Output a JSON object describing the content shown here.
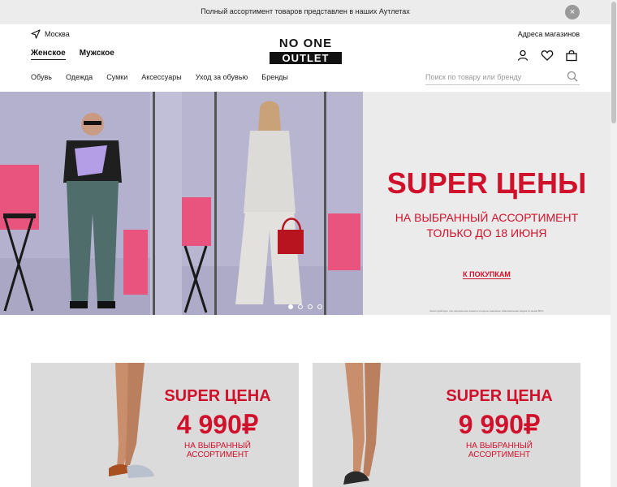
{
  "topbar": {
    "text": "Полный ассортимент товаров представлен в наших Аутлетах",
    "close": "×"
  },
  "header": {
    "city": "Москва",
    "store_link": "Адреса магазинов",
    "logo_top": "NO ONE",
    "logo_bottom": "OUTLET",
    "gender_tabs": [
      "Женское",
      "Мужское"
    ],
    "nav": [
      "Обувь",
      "Одежда",
      "Сумки",
      "Аксессуары",
      "Уход за обувью",
      "Бренды"
    ],
    "search_placeholder": "Поиск по товару или бренду"
  },
  "hero": {
    "title": "SUPER ЦЕНЫ",
    "subtitle_line1": "НА ВЫБРАННЫЙ АССОРТИМЕНТ",
    "subtitle_line2": "ТОЛЬКО ДО 18 ИЮНЯ",
    "cta": "К ПОКУПКАМ",
    "footnote": "Акция действует при оформлении заказа в интернет-магазине. Максимальная скидка по акции 80%.",
    "slides_count": 4,
    "active_slide": 1
  },
  "promos": [
    {
      "title": "SUPER ЦЕНА",
      "price": "4 990₽",
      "subtitle": "НА ВЫБРАННЫЙ АССОРТИМЕНТ"
    },
    {
      "title": "SUPER ЦЕНА",
      "price": "9 990₽",
      "subtitle": "НА ВЫБРАННЫЙ АССОРТИМЕНТ"
    }
  ],
  "colors": {
    "accent": "#d0112b",
    "topbar": "#ececec",
    "hero_bg": "#ebebeb"
  },
  "icons": [
    "location-arrow-icon",
    "user-icon",
    "heart-icon",
    "bag-icon",
    "search-icon",
    "close-icon"
  ]
}
